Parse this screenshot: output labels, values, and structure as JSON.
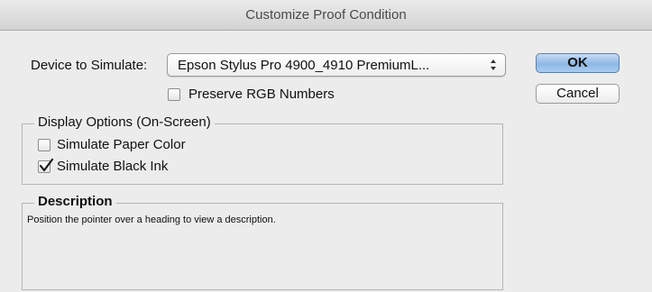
{
  "window": {
    "title": "Customize Proof Condition"
  },
  "device": {
    "label": "Device to Simulate:",
    "selected": "Epson Stylus Pro 4900_4910 PremiumL...",
    "preserve_rgb": {
      "label": "Preserve RGB Numbers",
      "checked": false
    }
  },
  "buttons": {
    "ok": "OK",
    "cancel": "Cancel"
  },
  "display_options": {
    "legend": "Display Options (On-Screen)",
    "simulate_paper_color": {
      "label": "Simulate Paper Color",
      "checked": false
    },
    "simulate_black_ink": {
      "label": "Simulate Black Ink",
      "checked": true
    }
  },
  "description": {
    "legend": "Description",
    "text": "Position the pointer over a heading to view a description."
  },
  "icons": {
    "popup_arrows": "updown-arrows-icon",
    "checkmark": "checkmark-icon"
  }
}
